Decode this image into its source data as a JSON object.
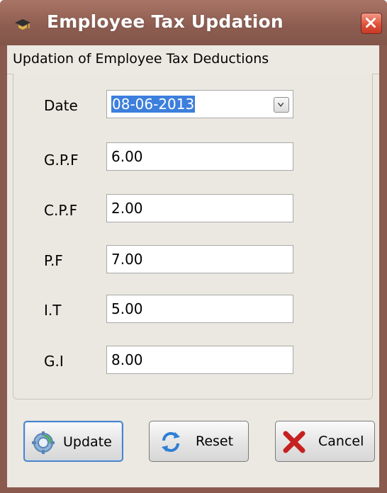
{
  "window": {
    "title": "Employee Tax Updation",
    "title_icon": "graduation-cap-icon",
    "close_icon": "close-icon",
    "accent_color": "#8c5c50"
  },
  "subtitle": "Updation of Employee Tax Deductions",
  "form": {
    "date": {
      "label": "Date",
      "value": "08-06-2013"
    },
    "gpf": {
      "label": "G.P.F",
      "value": "6.00"
    },
    "cpf": {
      "label": "C.P.F",
      "value": "2.00"
    },
    "pf": {
      "label": "P.F",
      "value": "7.00"
    },
    "it": {
      "label": "I.T",
      "value": "5.00"
    },
    "gi": {
      "label": "G.I",
      "value": "8.00"
    }
  },
  "buttons": {
    "update": {
      "label": "Update",
      "icon": "gear-icon"
    },
    "reset": {
      "label": "Reset",
      "icon": "refresh-icon"
    },
    "cancel": {
      "label": "Cancel",
      "icon": "x-icon"
    }
  }
}
